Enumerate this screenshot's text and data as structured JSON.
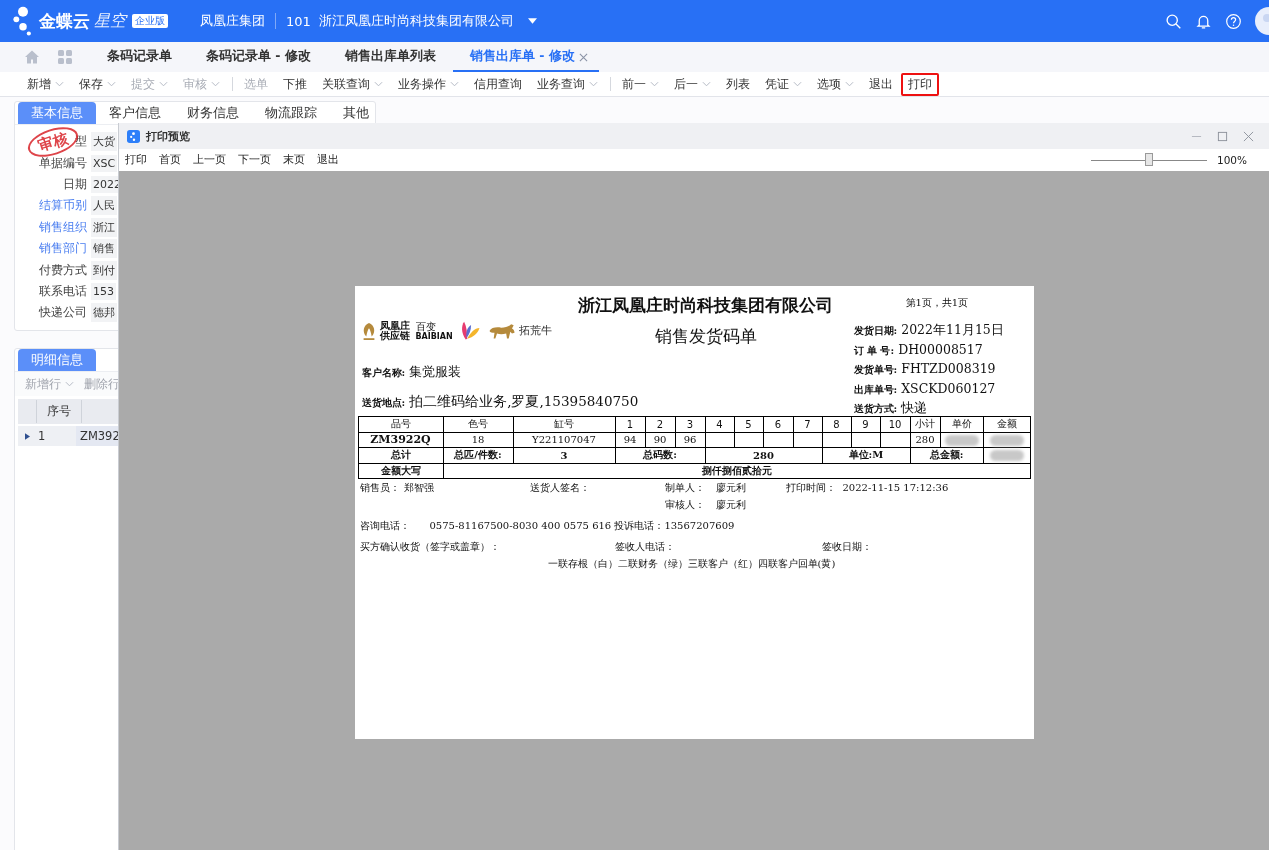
{
  "header": {
    "brand": "金蝶云",
    "product": "星空",
    "edition": "企业版",
    "group": "凤凰庄集团",
    "org_code": "101",
    "org_name": "浙江凤凰庄时尚科技集团有限公司"
  },
  "tabs": [
    {
      "label": "条码记录单",
      "selected": false
    },
    {
      "label": "条码记录单 - 修改",
      "selected": false
    },
    {
      "label": "销售出库单列表",
      "selected": false
    },
    {
      "label": "销售出库单 - 修改",
      "selected": true
    }
  ],
  "toolbar": {
    "groups": [
      [
        {
          "label": "新增",
          "dropdown": true,
          "disabled": false,
          "highlighted": false
        },
        {
          "label": "保存",
          "dropdown": true,
          "disabled": false,
          "highlighted": false
        },
        {
          "label": "提交",
          "dropdown": true,
          "disabled": true,
          "highlighted": false
        },
        {
          "label": "审核",
          "dropdown": true,
          "disabled": true,
          "highlighted": false
        }
      ],
      [
        {
          "label": "选单",
          "dropdown": false,
          "disabled": true,
          "highlighted": false
        },
        {
          "label": "下推",
          "dropdown": false,
          "disabled": false,
          "highlighted": false
        },
        {
          "label": "关联查询",
          "dropdown": true,
          "disabled": false,
          "highlighted": false
        },
        {
          "label": "业务操作",
          "dropdown": true,
          "disabled": false,
          "highlighted": false
        },
        {
          "label": "信用查询",
          "dropdown": false,
          "disabled": false,
          "highlighted": false
        },
        {
          "label": "业务查询",
          "dropdown": true,
          "disabled": false,
          "highlighted": false
        }
      ],
      [
        {
          "label": "前一",
          "dropdown": true,
          "disabled": false,
          "highlighted": false
        },
        {
          "label": "后一",
          "dropdown": true,
          "disabled": false,
          "highlighted": false
        },
        {
          "label": "列表",
          "dropdown": false,
          "disabled": false,
          "highlighted": false
        },
        {
          "label": "凭证",
          "dropdown": true,
          "disabled": false,
          "highlighted": false
        },
        {
          "label": "选项",
          "dropdown": true,
          "disabled": false,
          "highlighted": false
        },
        {
          "label": "退出",
          "dropdown": false,
          "disabled": false,
          "highlighted": false
        },
        {
          "label": "打印",
          "dropdown": false,
          "disabled": false,
          "highlighted": true
        }
      ]
    ]
  },
  "form": {
    "tabs": [
      {
        "label": "基本信息",
        "selected": true
      },
      {
        "label": "客户信息",
        "selected": false
      },
      {
        "label": "财务信息",
        "selected": false
      },
      {
        "label": "物流跟踪",
        "selected": false
      },
      {
        "label": "其他",
        "selected": false
      }
    ],
    "stamp": "审核",
    "fields": [
      {
        "label": "型",
        "value": "大货",
        "link": false
      },
      {
        "label": "单据编号",
        "value": "XSC",
        "link": false
      },
      {
        "label": "日期",
        "value": "2022",
        "link": false
      },
      {
        "label": "结算币别",
        "value": "人民",
        "link": true
      },
      {
        "label": "销售组织",
        "value": "浙江",
        "link": true
      },
      {
        "label": "销售部门",
        "value": "销售",
        "link": true
      },
      {
        "label": "付费方式",
        "value": "到付",
        "link": false
      },
      {
        "label": "联系电话",
        "value": "153",
        "link": false
      },
      {
        "label": "快递公司",
        "value": "德邦",
        "link": false
      }
    ]
  },
  "detail": {
    "tabs": [
      {
        "label": "明细信息",
        "selected": true
      }
    ],
    "actions": [
      {
        "label": "新增行",
        "dropdown": true
      },
      {
        "label": "删除行",
        "dropdown": false
      }
    ],
    "columns": [
      "序号"
    ],
    "rows": [
      {
        "seq": "1",
        "column_2": "ZM392",
        "current": true
      }
    ]
  },
  "preview": {
    "title": "打印预览",
    "actions": [
      "打印",
      "首页",
      "上一页",
      "下一页",
      "末页",
      "退出"
    ],
    "zoom": {
      "level": 0.5,
      "reading": "100%"
    },
    "page": {
      "company": "浙江凤凰庄时尚科技集团有限公司",
      "page_info": "第1页，共1页",
      "title": "销售发货码单",
      "logos": [
        {
          "kind": "phoenix",
          "lines": [
            "凤凰庄",
            "供应链"
          ]
        },
        {
          "kind": "butterfly",
          "lines": [
            "百变",
            "BAIBIAN"
          ]
        },
        {
          "kind": "bull",
          "lines": [
            "拓荒牛"
          ]
        }
      ],
      "customer": {
        "label": "客户名称:",
        "value": "集觉服装"
      },
      "address": {
        "label": "送货地点:",
        "value": "拍二维码给业务,罗夏,15395840750"
      },
      "info": [
        {
          "label": "发货日期:",
          "value": "2022年11月15日"
        },
        {
          "label": "订 单 号:",
          "value": "DH00008517"
        },
        {
          "label": "发货单号:",
          "value": "FHTZD008319"
        },
        {
          "label": "出库单号:",
          "value": "XSCKD060127"
        },
        {
          "label": "送货方式:",
          "value": "快递"
        }
      ],
      "table": {
        "columns": [
          "品号",
          "色号",
          "缸号",
          "1",
          "2",
          "3",
          "4",
          "5",
          "6",
          "7",
          "8",
          "9",
          "10",
          "小计",
          "单价",
          "金额"
        ],
        "rows": [
          {
            "cells": [
              "ZM3922Q",
              "18",
              "Y221107047",
              "94",
              "90",
              "96",
              null,
              null,
              null,
              null,
              null,
              null,
              null,
              "280"
            ],
            "redacted": true
          }
        ],
        "totals": {
          "label": "总计",
          "pieces_label": "总匹/件数:",
          "pieces": "3",
          "yards_label": "总码数:",
          "yards": "280",
          "unit": "单位:M",
          "amount_label": "总金额:",
          "amount_redacted": true
        },
        "amount_words": {
          "label": "金额大写",
          "value": "捌仟捌佰贰拾元"
        }
      },
      "footer": {
        "salesperson": {
          "label": "销售员：",
          "value": "郑智强"
        },
        "deliverer": {
          "label": "送货人签名："
        },
        "maker": {
          "label": "制单人：",
          "value": "廖元利"
        },
        "print_time": {
          "label": "打印时间：",
          "value": "2022-11-15 17:12:36"
        },
        "auditor": {
          "label": "审核人：",
          "value": "廖元利"
        },
        "contact": {
          "label": "咨询电话：",
          "value": "0575-81167500-8030 400 0575 616 投诉电话：13567207609"
        },
        "buyer_confirm": {
          "label": "买方确认收货（签字或盖章）："
        },
        "receiver_phone": {
          "label": "签收人电话："
        },
        "receipt_date": {
          "label": "签收日期："
        },
        "copies_note": "一联存根（白）二联财务（绿）三联客户（红）四联客户回单(黄)"
      }
    }
  }
}
